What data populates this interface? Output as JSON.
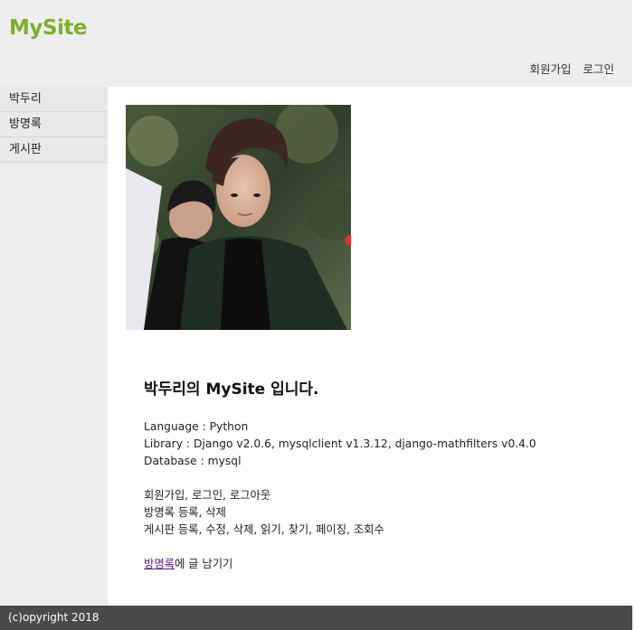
{
  "header": {
    "logo": "MySite",
    "nav": {
      "join": "회원가입",
      "login": "로그인"
    }
  },
  "sidebar": {
    "items": [
      {
        "label": "박두리"
      },
      {
        "label": "방명록"
      },
      {
        "label": "게시판"
      }
    ]
  },
  "main": {
    "title": "박두리의 MySite 입니다.",
    "info": {
      "language": "Language : Python",
      "library": "Library : Django v2.0.6, mysqlclient v1.3.12, django-mathfilters v0.4.0",
      "database": "Database : mysql"
    },
    "features": [
      "회원가입, 로그인, 로그아웃",
      "방명록 등록, 삭제",
      "게시판 등록, 수정, 삭제, 읽기, 찾기, 페이징, 조회수"
    ],
    "guestbook_link": "방명록",
    "guestbook_suffix": "에 글 남기기"
  },
  "footer": {
    "copyright": "(c)opyright 2018"
  },
  "colors": {
    "logo": "#7cb02c",
    "header_bg": "#eeeeee",
    "footer_bg": "#4a4a4a",
    "link_visited": "#551a8b"
  }
}
